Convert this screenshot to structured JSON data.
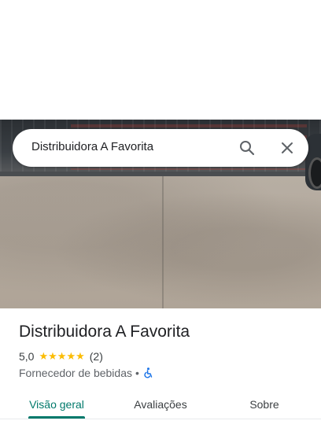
{
  "search": {
    "query": "Distribuidora A Favorita"
  },
  "place": {
    "name": "Distribuidora A Favorita",
    "rating": "5,0",
    "stars": [
      "★",
      "★",
      "★",
      "★",
      "★"
    ],
    "reviews_count": "(2)",
    "category": "Fornecedor de bebidas",
    "separator": "•"
  },
  "tabs": [
    {
      "label": "Visão geral",
      "active": true
    },
    {
      "label": "Avaliações",
      "active": false
    },
    {
      "label": "Sobre",
      "active": false
    }
  ],
  "colors": {
    "accent": "#00796b",
    "star": "#fbbc04",
    "accessibility": "#1a73e8"
  },
  "icons": {
    "search": "search-icon",
    "close": "close-icon",
    "accessibility": "wheelchair-accessible-icon"
  }
}
